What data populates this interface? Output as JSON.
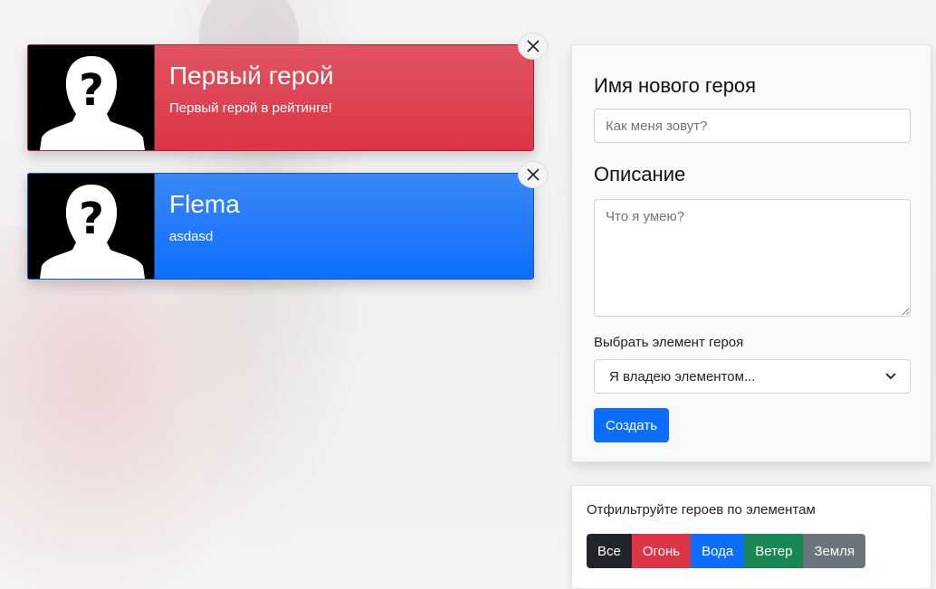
{
  "heroes": [
    {
      "name": "Первый герой",
      "description": "Первый герой в рейтинге!",
      "color": "#dc3545",
      "avatar_icon": "unknown-person-icon",
      "close_icon": "close-icon"
    },
    {
      "name": "Flema",
      "description": "asdasd",
      "color": "#0d6efd",
      "avatar_icon": "unknown-person-icon",
      "close_icon": "close-icon"
    }
  ],
  "form": {
    "name_heading": "Имя нового героя",
    "name_placeholder": "Как меня зовут?",
    "name_value": "",
    "description_heading": "Описание",
    "description_placeholder": "Что я умею?",
    "description_value": "",
    "element_label": "Выбрать элемент героя",
    "element_selected": "Я владею элементом...",
    "submit_label": "Создать"
  },
  "filter": {
    "title": "Отфильтруйте героев по элементам",
    "buttons": [
      {
        "label": "Все",
        "color": "#212529"
      },
      {
        "label": "Огонь",
        "color": "#dc3545"
      },
      {
        "label": "Вода",
        "color": "#0d6efd"
      },
      {
        "label": "Ветер",
        "color": "#198754"
      },
      {
        "label": "Земля",
        "color": "#6c757d"
      }
    ]
  }
}
